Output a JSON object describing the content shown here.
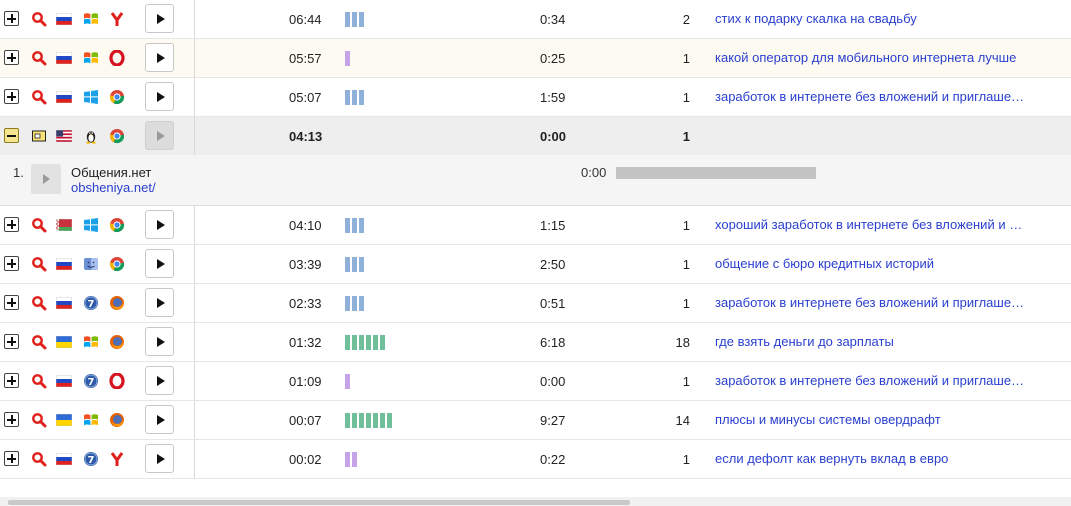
{
  "colors": {
    "bar_blue": "#8fb0d8",
    "bar_purple": "#c5a3e8",
    "bar_green": "#6fbf9a",
    "link": "#2a3fd0"
  },
  "rows": [
    {
      "time": "06:44",
      "bars": 3,
      "bar_color": "#8fb0d8",
      "duration": "0:34",
      "views": "2",
      "query": "стих к подарку скалка на свадьбу",
      "icons": [
        "magnifier-icon",
        "flag-ru-icon",
        "windows-xp-icon",
        "yandex-browser-icon"
      ]
    },
    {
      "time": "05:57",
      "bars": 1,
      "bar_color": "#c5a3e8",
      "duration": "0:25",
      "views": "1",
      "query": "какой оператор для мобильного интернета лучше",
      "icons": [
        "magnifier-icon",
        "flag-ru-icon",
        "windows-xp-icon",
        "opera-icon"
      ]
    },
    {
      "time": "05:07",
      "bars": 3,
      "bar_color": "#8fb0d8",
      "duration": "1:59",
      "views": "1",
      "query": "заработок в интернете без вложений и приглаше…",
      "icons": [
        "magnifier-icon",
        "flag-ru-icon",
        "windows-8-icon",
        "chrome-icon"
      ]
    },
    {
      "time": "04:13",
      "bars": 0,
      "bar_color": "#8fb0d8",
      "duration": "0:00",
      "views": "1",
      "query": "",
      "icons": [
        "direct-entry-icon",
        "flag-us-icon",
        "linux-icon",
        "chrome-icon"
      ]
    },
    {
      "time": "04:10",
      "bars": 3,
      "bar_color": "#8fb0d8",
      "duration": "1:15",
      "views": "1",
      "query": "хороший заработок в интернете без вложений и …",
      "icons": [
        "magnifier-icon",
        "flag-by-icon",
        "windows-8-icon",
        "chrome-icon"
      ]
    },
    {
      "time": "03:39",
      "bars": 3,
      "bar_color": "#8fb0d8",
      "duration": "2:50",
      "views": "1",
      "query": "общение с бюро кредитных историй",
      "icons": [
        "magnifier-icon",
        "flag-ru-icon",
        "mac-os-icon",
        "chrome-icon"
      ]
    },
    {
      "time": "02:33",
      "bars": 3,
      "bar_color": "#8fb0d8",
      "duration": "0:51",
      "views": "1",
      "query": "заработок в интернете без вложений и приглаше…",
      "icons": [
        "magnifier-icon",
        "flag-ru-icon",
        "windows-7-icon",
        "firefox-icon"
      ]
    },
    {
      "time": "01:32",
      "bars": 6,
      "bar_color": "#6fbf9a",
      "duration": "6:18",
      "views": "18",
      "query": "где взять деньги до зарплаты",
      "icons": [
        "magnifier-icon",
        "flag-ua-icon",
        "windows-xp-icon",
        "firefox-icon"
      ]
    },
    {
      "time": "01:09",
      "bars": 1,
      "bar_color": "#c5a3e8",
      "duration": "0:00",
      "views": "1",
      "query": "заработок в интернете без вложений и приглаше…",
      "icons": [
        "magnifier-icon",
        "flag-ru-icon",
        "windows-7-icon",
        "opera-icon"
      ]
    },
    {
      "time": "00:07",
      "bars": 7,
      "bar_color": "#6fbf9a",
      "duration": "9:27",
      "views": "14",
      "query": "плюсы и минусы системы овердрафт",
      "icons": [
        "magnifier-icon",
        "flag-ua-icon",
        "windows-xp-icon",
        "firefox-icon"
      ]
    },
    {
      "time": "00:02",
      "bars": 2,
      "bar_color": "#c5a3e8",
      "duration": "0:22",
      "views": "1",
      "query": "если дефолт как вернуть вклад в евро",
      "icons": [
        "magnifier-icon",
        "flag-ru-icon",
        "windows-7-icon",
        "yandex-browser-icon"
      ]
    }
  ],
  "detail": {
    "index": "1.",
    "title": "Общения.нет",
    "url": "obsheniya.net/",
    "time": "0:00"
  }
}
